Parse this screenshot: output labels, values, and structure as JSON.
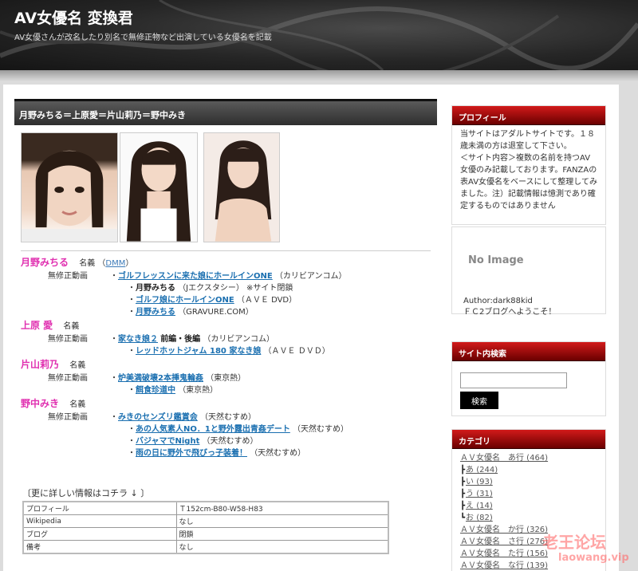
{
  "header": {
    "title": "AV女優名 変換君",
    "subtitle": "AV女優さんが改名したり別名で無修正物など出演している女優名を記載"
  },
  "post": {
    "title": "月野みちる＝上原愛＝片山莉乃＝野中みき",
    "actresses": [
      {
        "name": "月野みちる",
        "label": "名義",
        "dmm": "DMM",
        "category": "無修正動画",
        "items": [
          {
            "link": "ゴルフレッスンに来た娘にホールインONE",
            "note": "（カリビアンコム）"
          },
          {
            "bold": "月野みちる",
            "note": "（Jエクスタシー） ※サイト閉鎖"
          },
          {
            "link": "ゴルフ娘にホールインONE",
            "note": "（ＡＶＥ DVD）"
          },
          {
            "link": "月野みちる",
            "note": "（GRAVURE.COM）"
          }
        ]
      },
      {
        "name": "上原 愛",
        "label": "名義",
        "category": "無修正動画",
        "items": [
          {
            "link": "家なき娘２",
            "bold": "前編・後編",
            "note": "（カリビアンコム）"
          },
          {
            "link": "レッドホットジャム 180 家なき娘",
            "note": "（ＡＶＥ ＤＶＤ）"
          }
        ]
      },
      {
        "name": "片山莉乃",
        "label": "名義",
        "category": "無修正動画",
        "items": [
          {
            "link": "炉美満破壊2本挿鬼輪姦",
            "note": "（東京熱）"
          },
          {
            "link": "餌食珍道中",
            "note": "（東京熱）"
          }
        ]
      },
      {
        "name": "野中みき",
        "label": "名義",
        "category": "無修正動画",
        "items": [
          {
            "link": "みきのセンズリ鑑賞会",
            "note": "（天然むすめ）"
          },
          {
            "link": "あの人気素人NO．1と野外露出青姦デート",
            "note": "（天然むすめ）"
          },
          {
            "link": "バジャマでNight",
            "note": "（天然むすめ）"
          },
          {
            "link": "雨の日に野外で飛びっ子装着！",
            "note": "（天然むすめ）"
          }
        ]
      }
    ],
    "more_label": "〔更に詳しい情報はコチラ ↓ 〕",
    "info_table": [
      [
        "プロフィール",
        "Ｔ152cm-B80-W58-H83"
      ],
      [
        "Wikipedia",
        "なし"
      ],
      [
        "ブログ",
        "閉鎖"
      ],
      [
        "備考",
        "なし"
      ]
    ]
  },
  "sidebar": {
    "profile": {
      "title": "プロフィール",
      "text": "当サイトはアダルトサイトです。１８歳未満の方は退室して下さい。　　　＜サイト内容＞複数の名前を持つAV女優のみ記載しております。FANZAの表AV女優名をベースにして整理してみました。注）記載情報は憶測であり確定するものではありません",
      "no_image": "No Image",
      "author": "Author:dark88kid",
      "welcome": "ＦＣ2ブログへようこそ！"
    },
    "search": {
      "title": "サイト内検索",
      "button": "検索",
      "placeholder": ""
    },
    "categories": {
      "title": "カテゴリ",
      "items": [
        {
          "type": "main",
          "text": "ＡＶ女優名　あ行 (464)"
        },
        {
          "type": "sub",
          "bar": "┣",
          "text": "あ (244)"
        },
        {
          "type": "sub",
          "bar": "┣",
          "text": "い (93)"
        },
        {
          "type": "sub",
          "bar": "┣",
          "text": "う (31)"
        },
        {
          "type": "sub",
          "bar": "┣",
          "text": "え (14)"
        },
        {
          "type": "sub",
          "bar": "┗",
          "text": "お (82)"
        },
        {
          "type": "main",
          "text": "ＡＶ女優名　か行 (326)"
        },
        {
          "type": "main",
          "text": "ＡＶ女優名　さ行 (276)"
        },
        {
          "type": "main",
          "text": "ＡＶ女優名　た行 (156)"
        },
        {
          "type": "main",
          "text": "ＡＶ女優名　な行 (139)"
        }
      ]
    }
  },
  "watermark": {
    "line1": "老王论坛",
    "line2": "laowang.vip"
  }
}
